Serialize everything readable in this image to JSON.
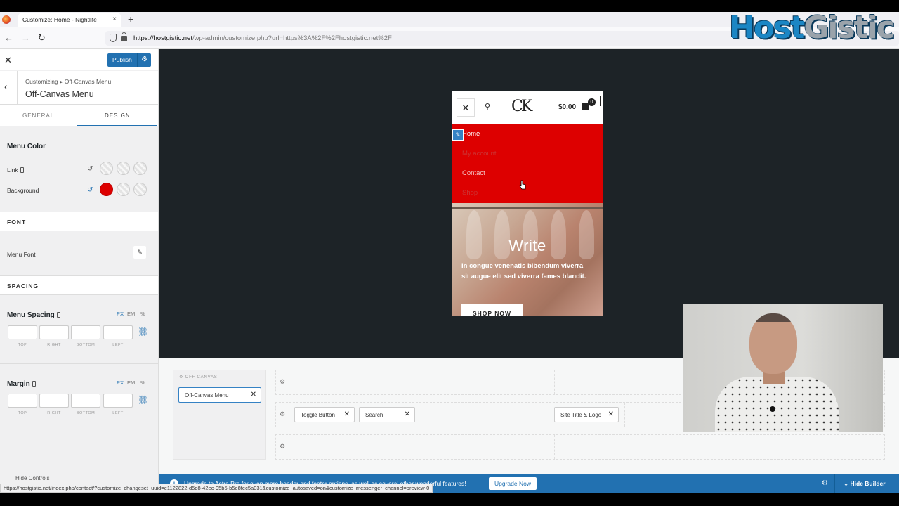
{
  "browser": {
    "tab_title": "Customize: Home - Nightlife",
    "tab_close": "×",
    "new_tab": "+",
    "url_host": "https://hostgistic.net",
    "url_rest": "/wp-admin/customize.php?url=https%3A%2F%2Fhostgistic.net%2F",
    "back": "←",
    "forward": "→",
    "reload": "↻",
    "watermark_a": "Host",
    "watermark_b": "Gistic"
  },
  "panel": {
    "close": "✕",
    "publish_label": "Publish",
    "breadcrumb": "Customizing ▸ Off-Canvas Menu",
    "title": "Off-Canvas Menu",
    "tabs": [
      {
        "label": "GENERAL"
      },
      {
        "label": "DESIGN"
      }
    ],
    "menu_color_heading": "Menu Color",
    "link_label": "Link",
    "background_label": "Background",
    "font_heading": "FONT",
    "menu_font_label": "Menu Font",
    "spacing_heading": "SPACING",
    "menu_spacing_label": "Menu Spacing",
    "margin_label": "Margin",
    "units": [
      "PX",
      "EM",
      "%"
    ],
    "dim_labels": [
      "TOP",
      "RIGHT",
      "BOTTOM",
      "LEFT"
    ],
    "hide_controls": "Hide Controls",
    "background_color": "#dd0000"
  },
  "preview": {
    "logo": "CK",
    "cart_total": "$0.00",
    "cart_count": "0",
    "menu_items": [
      "Home",
      "My account",
      "Contact",
      "Shop"
    ],
    "hero_title": "Write",
    "hero_text": "In congue venenatis bibendum viverra sit augue elit sed viverra fames blandit.",
    "shop_button": "SHOP NOW"
  },
  "builder": {
    "off_canvas_label": "OFF CANVAS",
    "off_canvas_item": "Off-Canvas Menu",
    "toggle_button": "Toggle Button",
    "search": "Search",
    "site_title_logo": "Site Title & Logo"
  },
  "bottom_bar": {
    "info": "i",
    "message": "Upgrade to Astra Pro for even more header and footer options, as well as several other wonderful features!",
    "upgrade_button": "Upgrade Now",
    "hide_builder": "Hide Builder"
  },
  "status_url": "https://hostgistic.net/index.php/contact/?customize_changeset_uuid=e1122822-d5d8-42ec-95b5-b5e8fec5a031&customize_autosaved=on&customize_messenger_channel=preview-0"
}
